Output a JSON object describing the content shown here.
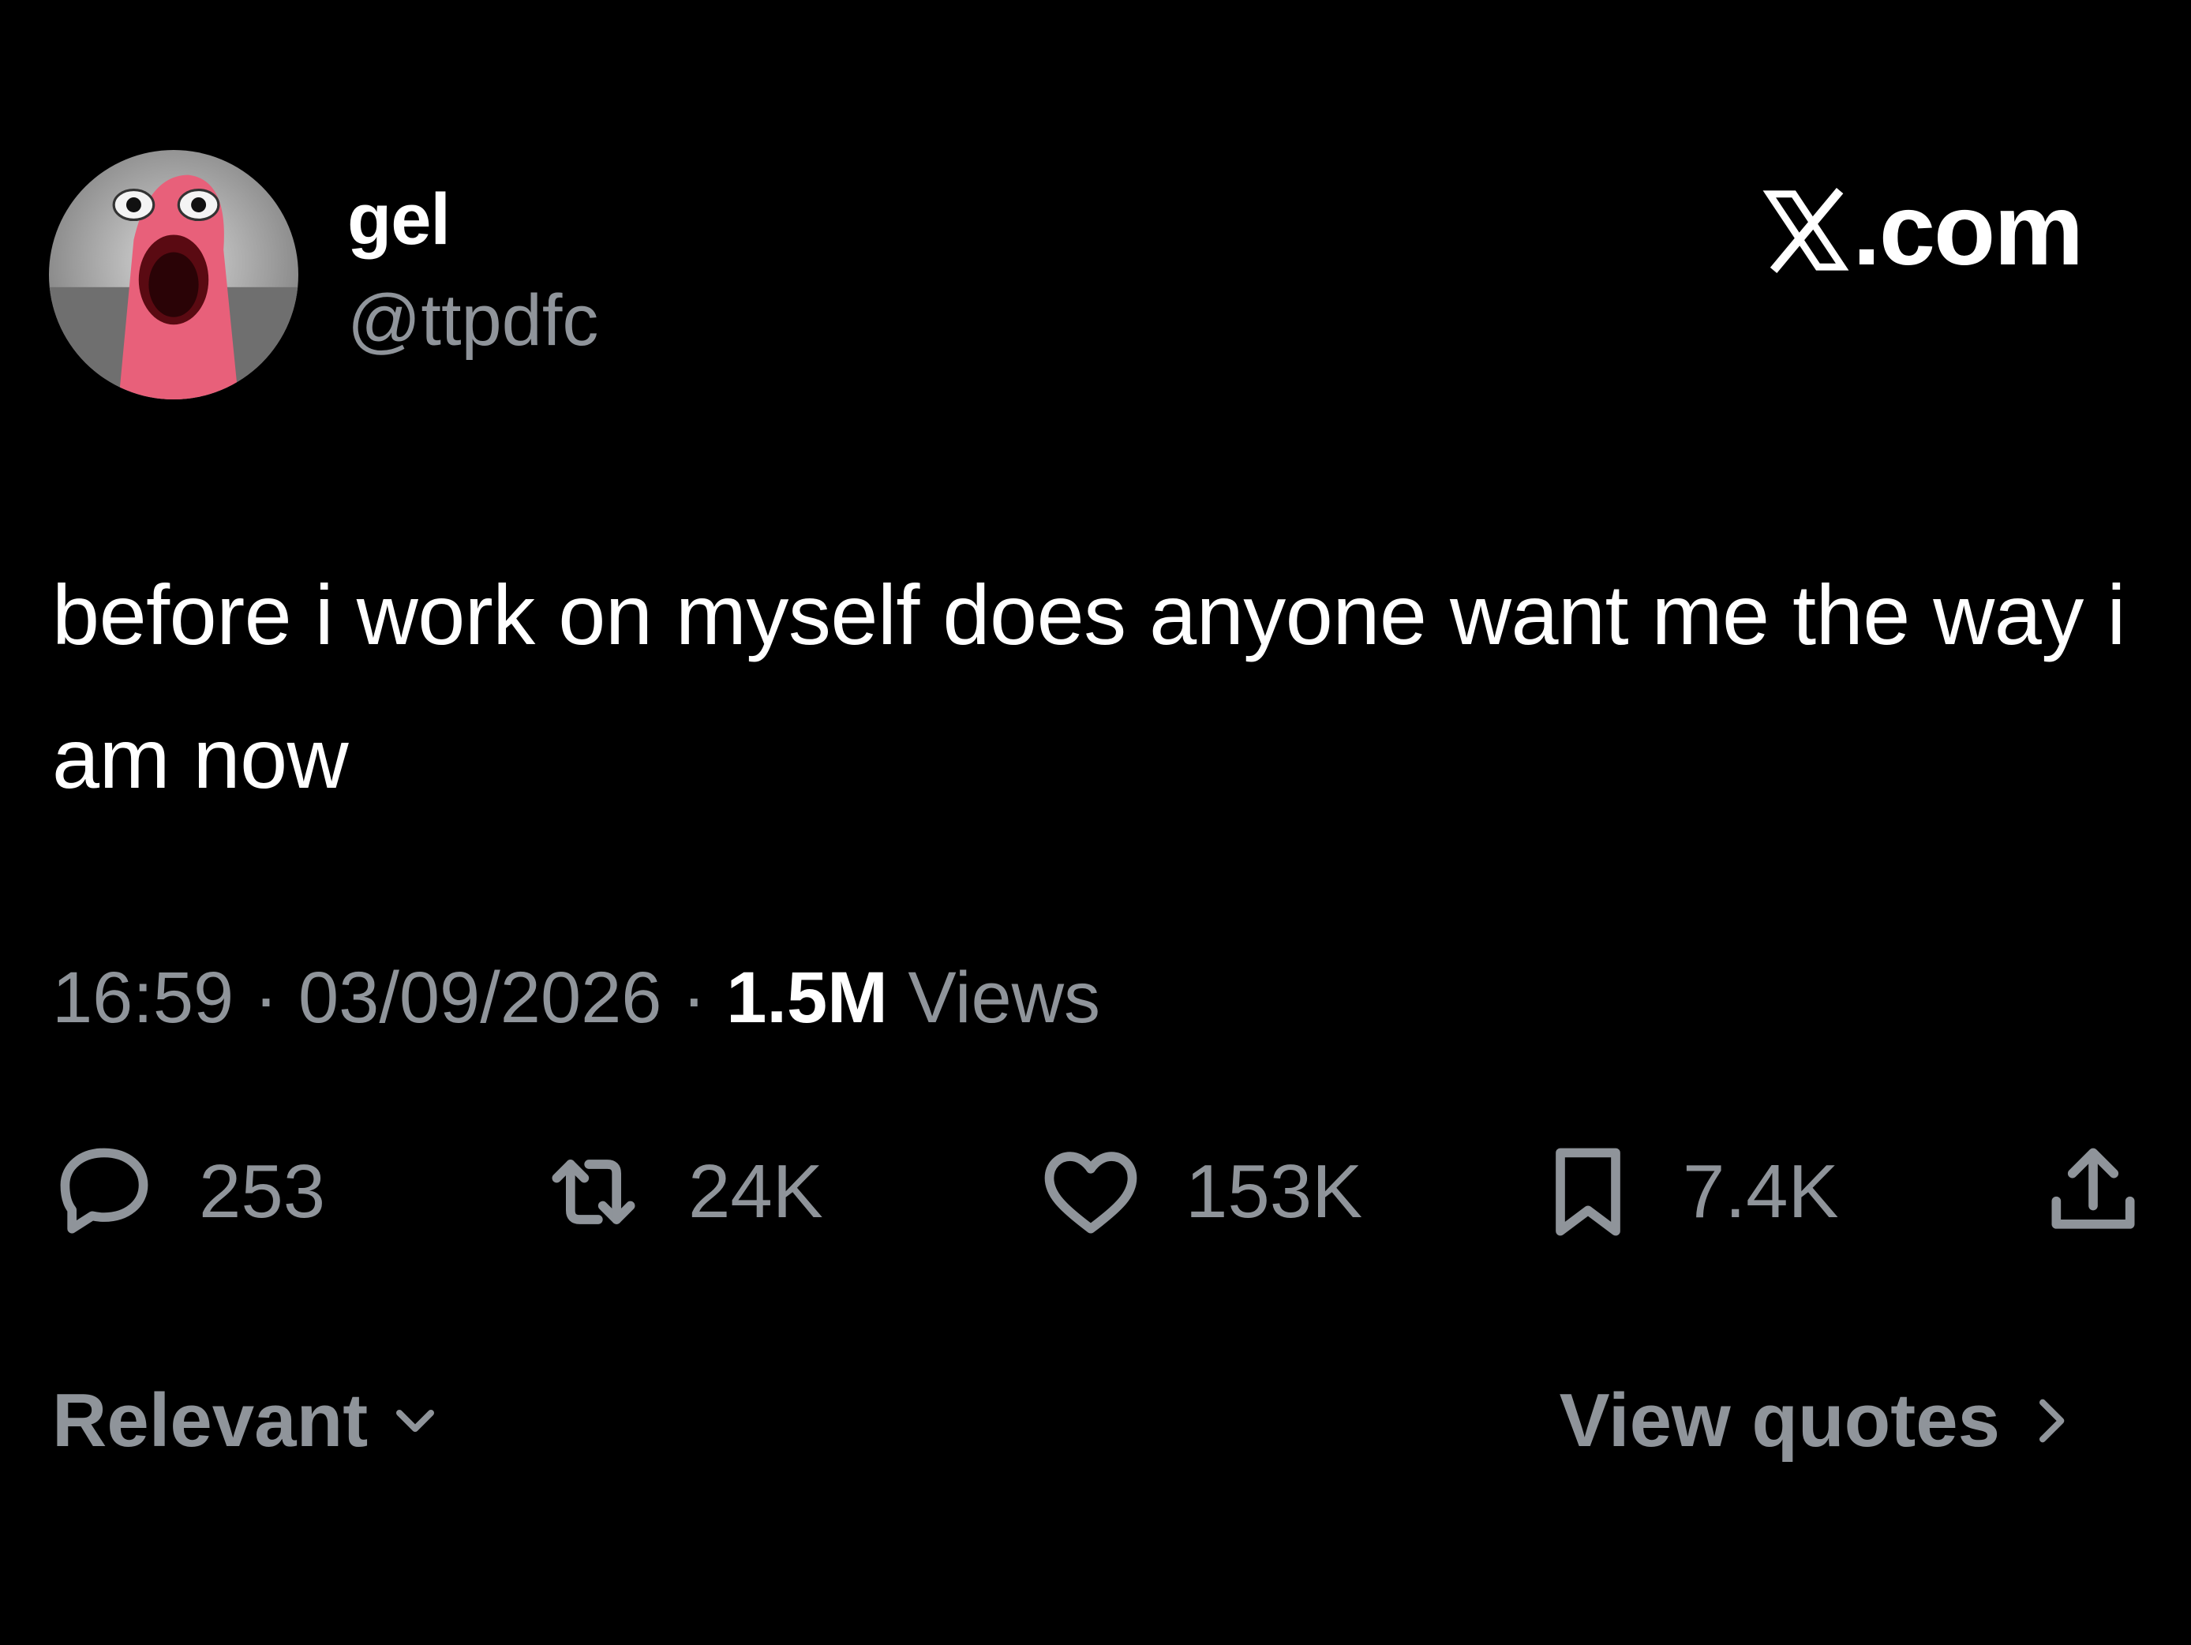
{
  "author": {
    "display_name": "gel",
    "handle": "@ttpdfc",
    "avatar_icon": "screaming-pink-starfish-avatar"
  },
  "brand": {
    "label": ".com",
    "icon": "x-logo-icon"
  },
  "tweet": {
    "text": "before i work on myself does anyone want me the way i am now"
  },
  "meta": {
    "time": "16:59",
    "separator": "·",
    "date": "03/09/2026",
    "views_count": "1.5M",
    "views_label": "Views"
  },
  "actions": {
    "replies": "253",
    "reposts": "24K",
    "likes": "153K",
    "bookmarks": "7.4K"
  },
  "footer": {
    "sort_label": "Relevant",
    "view_quotes_label": "View quotes"
  },
  "colors": {
    "background": "#000000",
    "primary_text": "#ffffff",
    "secondary_text": "#8f949a",
    "avatar_pink": "#e8607a"
  }
}
